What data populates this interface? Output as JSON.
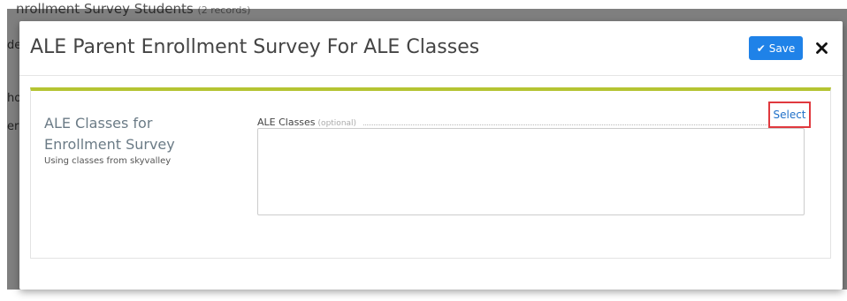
{
  "background": {
    "title": "nrollment Survey Students",
    "count": "(2 records)",
    "fragments": [
      "de",
      "ho",
      "era"
    ]
  },
  "modal": {
    "title": "ALE Parent Enrollment Survey For ALE Classes",
    "save_label": "Save",
    "save_icon": "check-icon",
    "close_icon": "close-icon"
  },
  "section": {
    "title": "ALE Classes for Enrollment Survey",
    "subtitle": "Using classes from skyvalley"
  },
  "field": {
    "label": "ALE Classes",
    "optional": "(optional)",
    "select_label": "Select",
    "value": ""
  },
  "colors": {
    "accent": "#1f82e8",
    "panel_top_border": "#b5c432",
    "highlight": "#e0393e",
    "link": "#1f6fc8"
  }
}
